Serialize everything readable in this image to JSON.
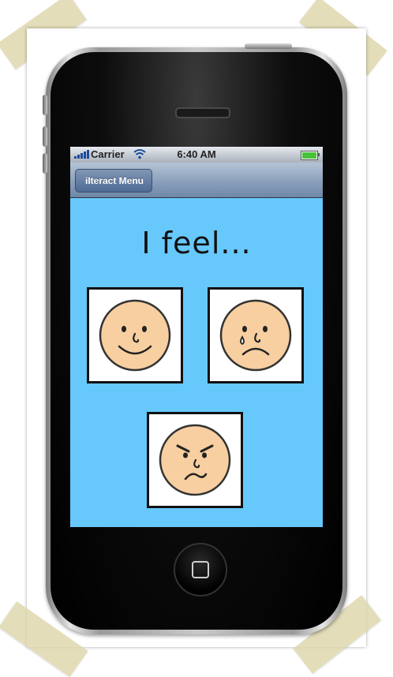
{
  "status_bar": {
    "carrier": "Carrier",
    "time": "6:40 AM",
    "battery_level": 1.0
  },
  "nav_bar": {
    "back_label": "iIteract Menu"
  },
  "screen": {
    "heading": "I feel...",
    "faces": [
      {
        "name": "happy-face",
        "icon": "happy-face-icon"
      },
      {
        "name": "sad-face",
        "icon": "sad-crying-face-icon"
      },
      {
        "name": "angry-face",
        "icon": "angry-face-icon"
      }
    ]
  },
  "colors": {
    "screen_background": "#67c8fb",
    "face_skin": "#f7cfa0"
  }
}
